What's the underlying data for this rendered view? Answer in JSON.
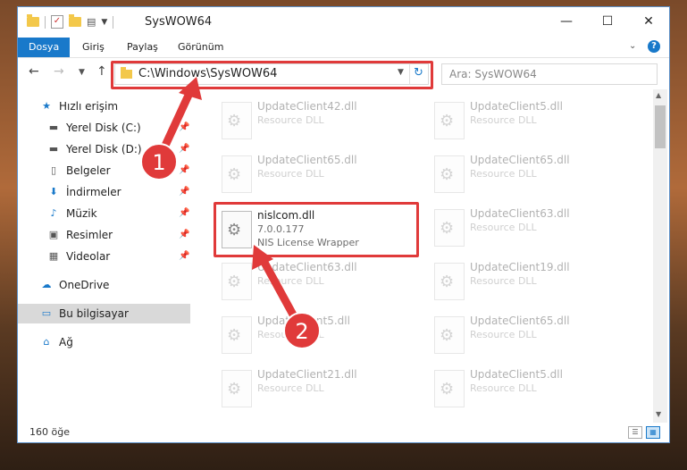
{
  "window": {
    "title": "SysWOW64"
  },
  "ribbon": {
    "tabs": [
      "Dosya",
      "Giriş",
      "Paylaş",
      "Görünüm"
    ]
  },
  "address": {
    "path": "C:\\Windows\\SysWOW64"
  },
  "search": {
    "placeholder": "Ara: SysWOW64"
  },
  "sidebar": {
    "items": [
      {
        "label": "Hızlı erişim"
      },
      {
        "label": "Yerel Disk (C:)"
      },
      {
        "label": "Yerel Disk (D:)"
      },
      {
        "label": "Belgeler"
      },
      {
        "label": "İndirmeler"
      },
      {
        "label": "Müzik"
      },
      {
        "label": "Resimler"
      },
      {
        "label": "Videolar"
      },
      {
        "label": "OneDrive"
      },
      {
        "label": "Bu bilgisayar"
      },
      {
        "label": "Ağ"
      }
    ]
  },
  "files": {
    "left": [
      {
        "name": "UpdateClient42.dll",
        "desc": "Resource DLL"
      },
      {
        "name": "UpdateClient65.dll",
        "desc": "Resource DLL"
      },
      {
        "name": "nislcom.dll",
        "version": "7.0.0.177",
        "desc": "NIS License Wrapper"
      },
      {
        "name": "UpdateClient63.dll",
        "desc": "Resource DLL"
      },
      {
        "name": "UpdateClient5.dll",
        "desc": "Resource DLL"
      },
      {
        "name": "UpdateClient21.dll",
        "desc": "Resource DLL"
      }
    ],
    "right": [
      {
        "name": "UpdateClient5.dll",
        "desc": "Resource DLL"
      },
      {
        "name": "UpdateClient65.dll",
        "desc": "Resource DLL"
      },
      {
        "name": "UpdateClient63.dll",
        "desc": "Resource DLL"
      },
      {
        "name": "UpdateClient19.dll",
        "desc": "Resource DLL"
      },
      {
        "name": "UpdateClient65.dll",
        "desc": "Resource DLL"
      },
      {
        "name": "UpdateClient5.dll",
        "desc": "Resource DLL"
      }
    ]
  },
  "annotations": {
    "step1": "1",
    "step2": "2",
    "color": "#e03a3a"
  },
  "status": {
    "count": "160 öğe"
  }
}
